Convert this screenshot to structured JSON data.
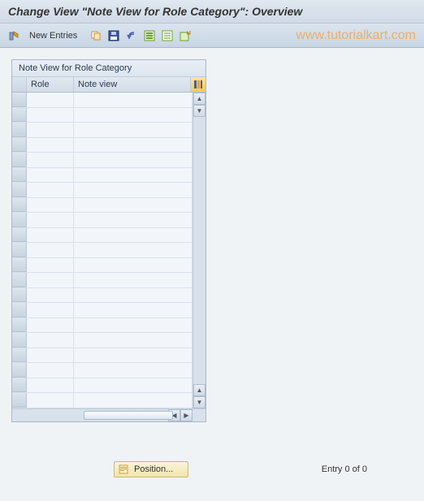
{
  "header": {
    "title": "Change View \"Note View for Role Category\": Overview"
  },
  "toolbar": {
    "new_entries_label": "New Entries"
  },
  "panel": {
    "title": "Note View for Role Category",
    "columns": {
      "role": "Role",
      "note_view": "Note view"
    },
    "rows": [
      {
        "role": "",
        "note_view": ""
      },
      {
        "role": "",
        "note_view": ""
      },
      {
        "role": "",
        "note_view": ""
      },
      {
        "role": "",
        "note_view": ""
      },
      {
        "role": "",
        "note_view": ""
      },
      {
        "role": "",
        "note_view": ""
      },
      {
        "role": "",
        "note_view": ""
      },
      {
        "role": "",
        "note_view": ""
      },
      {
        "role": "",
        "note_view": ""
      },
      {
        "role": "",
        "note_view": ""
      },
      {
        "role": "",
        "note_view": ""
      },
      {
        "role": "",
        "note_view": ""
      },
      {
        "role": "",
        "note_view": ""
      },
      {
        "role": "",
        "note_view": ""
      },
      {
        "role": "",
        "note_view": ""
      },
      {
        "role": "",
        "note_view": ""
      },
      {
        "role": "",
        "note_view": ""
      },
      {
        "role": "",
        "note_view": ""
      },
      {
        "role": "",
        "note_view": ""
      },
      {
        "role": "",
        "note_view": ""
      },
      {
        "role": "",
        "note_view": ""
      }
    ]
  },
  "footer": {
    "position_label": "Position...",
    "entry_text": "Entry 0 of 0"
  },
  "watermark": "www.tutorialkart.com"
}
